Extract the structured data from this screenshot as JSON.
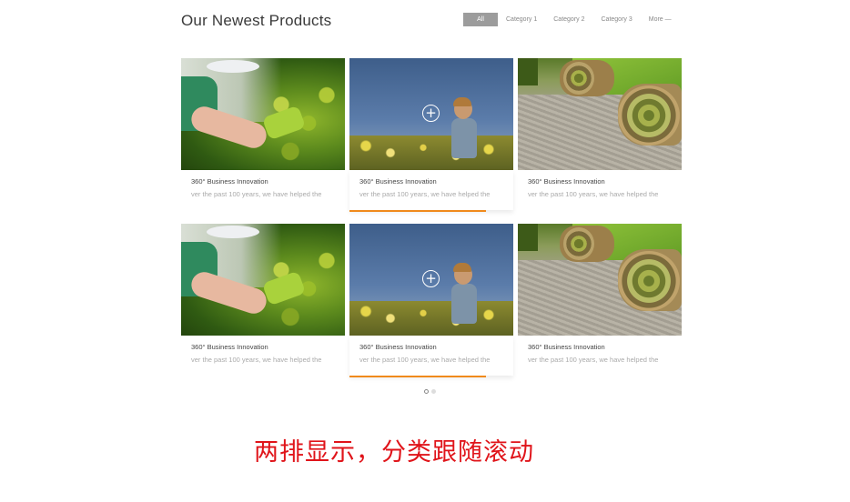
{
  "header": {
    "title": "Our Newest  Products",
    "filters": [
      "All",
      "Category 1",
      "Category 2",
      "Category 3",
      "More —"
    ],
    "active_filter": "All"
  },
  "rows": [
    {
      "cards": [
        {
          "image": "gardener-with-gloves-photo",
          "title": "360° Business Innovation",
          "text": "ver the past 100 years, we have helped the",
          "hover": false
        },
        {
          "image": "child-in-flower-field-photo",
          "title": "360° Business Innovation",
          "text": "ver the past 100 years, we have helped the",
          "hover": true
        },
        {
          "image": "turf-rolls-photo",
          "title": "360° Business Innovation",
          "text": "ver the past 100 years, we have helped the",
          "hover": false
        }
      ]
    },
    {
      "cards": [
        {
          "image": "gardener-with-gloves-photo",
          "title": "360° Business Innovation",
          "text": "ver the past 100 years, we have helped the",
          "hover": false
        },
        {
          "image": "child-in-flower-field-photo",
          "title": "360° Business Innovation",
          "text": "ver the past 100 years, we have helped the",
          "hover": true
        },
        {
          "image": "turf-rolls-photo",
          "title": "360° Business Innovation",
          "text": "ver the past 100 years, we have helped the",
          "hover": false
        }
      ]
    }
  ],
  "pagination": {
    "count": 2,
    "active": 1
  },
  "annotation": "两排显示，分类跟随滚动",
  "colors": {
    "accent": "#f08a1c",
    "active_filter_bg": "#9c9c9c",
    "annotation": "#e0141a"
  }
}
